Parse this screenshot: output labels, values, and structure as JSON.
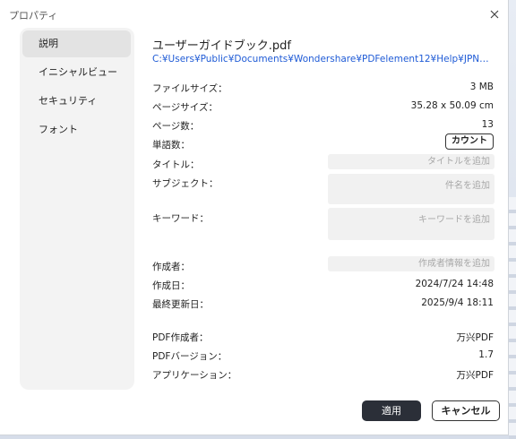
{
  "window": {
    "title": "プロパティ"
  },
  "sidebar": {
    "items": [
      {
        "label": "説明",
        "active": true
      },
      {
        "label": "イニシャルビュー",
        "active": false
      },
      {
        "label": "セキュリティ",
        "active": false
      },
      {
        "label": "フォント",
        "active": false
      }
    ]
  },
  "file": {
    "name": "ユーザーガイドブック.pdf",
    "path": "C:¥Users¥Public¥Documents¥Wondershare¥PDFelement12¥Help¥JPN¥ユーザーガイドブック.pdf"
  },
  "info": {
    "file_size": {
      "label": "ファイルサイズ：",
      "value": "3 MB"
    },
    "page_size": {
      "label": "ページサイズ：",
      "value": "35.28 x 50.09 cm"
    },
    "page_count": {
      "label": "ページ数：",
      "value": "13"
    },
    "word_count": {
      "label": "単語数：",
      "button": "カウント"
    }
  },
  "fields": {
    "title": {
      "label": "タイトル：",
      "placeholder": "タイトルを追加"
    },
    "subject": {
      "label": "サブジェクト：",
      "placeholder": "件名を追加"
    },
    "keywords": {
      "label": "キーワード：",
      "placeholder": "キーワードを追加"
    },
    "author": {
      "label": "作成者：",
      "placeholder": "作成者情報を追加"
    }
  },
  "dates": {
    "created": {
      "label": "作成日：",
      "value": "2024/7/24 14:48"
    },
    "modified": {
      "label": "最終更新日：",
      "value": "2025/9/4 18:11"
    }
  },
  "pdf": {
    "producer": {
      "label": "PDF作成者：",
      "value": "万兴PDF"
    },
    "version": {
      "label": "PDFバージョン：",
      "value": "1.7"
    },
    "application": {
      "label": "アプリケーション：",
      "value": "万兴PDF"
    }
  },
  "buttons": {
    "apply": "適用",
    "cancel": "キャンセル"
  },
  "colors": {
    "link": "#1f5bd6",
    "primary_button": "#2b2f38"
  }
}
